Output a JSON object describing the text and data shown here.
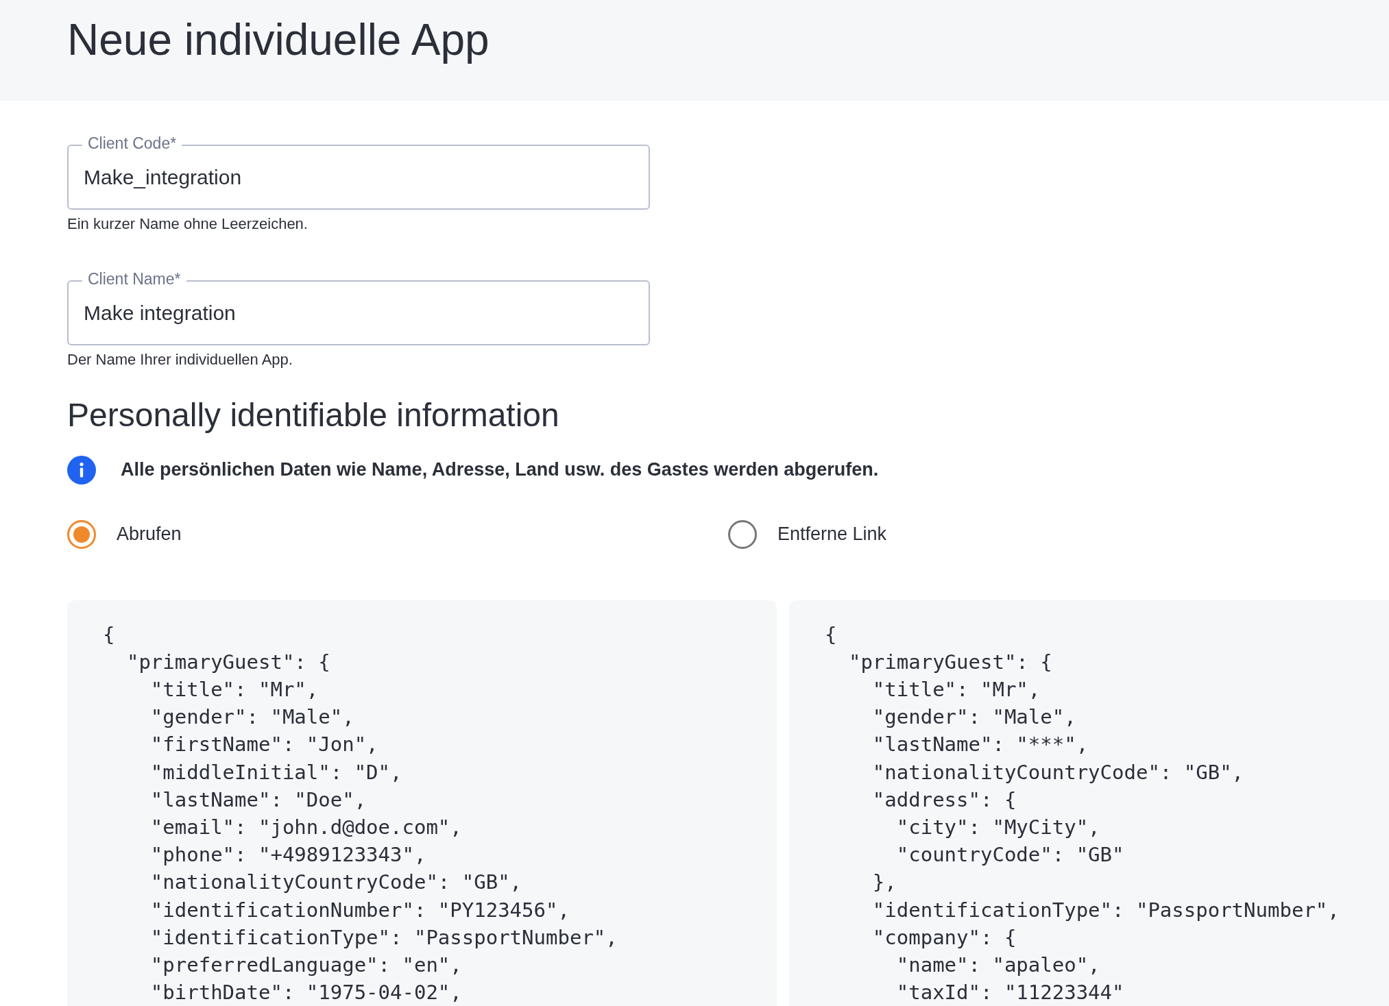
{
  "page_title": "Neue individuelle App",
  "fields": [
    {
      "label": "Client Code*",
      "value": "Make_integration",
      "help": "Ein kurzer Name ohne Leerzeichen."
    },
    {
      "label": "Client Name*",
      "value": "Make integration",
      "help": "Der Name Ihrer individuellen App."
    }
  ],
  "section_title": "Personally identifiable information",
  "info_text": "Alle persönlichen Daten wie Name, Adresse, Land usw. des Gastes werden abgerufen.",
  "radios": [
    {
      "label": "Abrufen",
      "selected": true
    },
    {
      "label": "Entferne Link",
      "selected": false
    }
  ],
  "code_panels": [
    {
      "lines": [
        "{",
        "  \"primaryGuest\": {",
        "    \"title\": \"Mr\",",
        "    \"gender\": \"Male\",",
        "    \"firstName\": \"Jon\",",
        "    \"middleInitial\": \"D\",",
        "    \"lastName\": \"Doe\",",
        "    \"email\": \"john.d@doe.com\",",
        "    \"phone\": \"+4989123343\",",
        "    \"nationalityCountryCode\": \"GB\",",
        "    \"identificationNumber\": \"PY123456\",",
        "    \"identificationType\": \"PassportNumber\",",
        "    \"preferredLanguage\": \"en\",",
        "    \"birthDate\": \"1975-04-02\","
      ]
    },
    {
      "lines": [
        "{",
        "  \"primaryGuest\": {",
        "    \"title\": \"Mr\",",
        "    \"gender\": \"Male\",",
        "    \"lastName\": \"***\",",
        "    \"nationalityCountryCode\": \"GB\",",
        "    \"address\": {",
        "      \"city\": \"MyCity\",",
        "      \"countryCode\": \"GB\"",
        "    },",
        "    \"identificationType\": \"PassportNumber\",",
        "    \"company\": {",
        "      \"name\": \"apaleo\",",
        "      \"taxId\": \"11223344\""
      ]
    }
  ]
}
